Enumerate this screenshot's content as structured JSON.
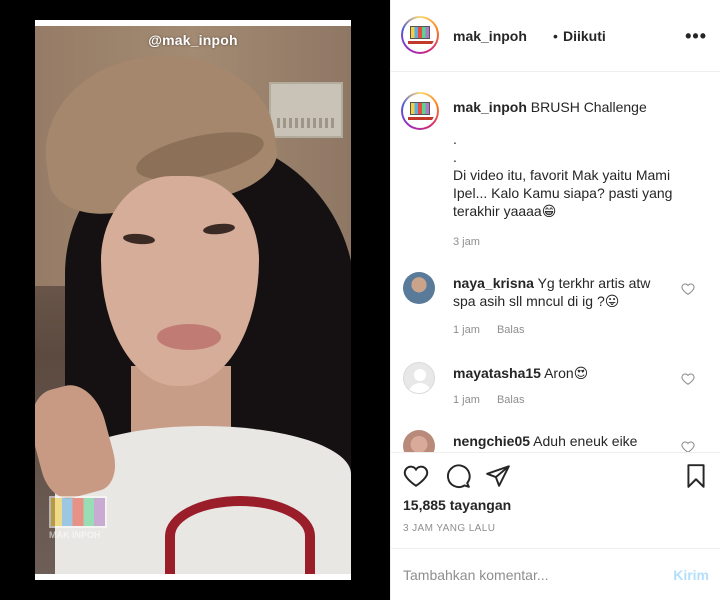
{
  "video": {
    "watermark": "@mak_inpoh",
    "logo_text": "MAK INPOH"
  },
  "header": {
    "username": "mak_inpoh",
    "separator": "•",
    "follow_status": "Diikuti",
    "more_icon": "more-horizontal-icon"
  },
  "caption": {
    "username": "mak_inpoh",
    "title": "BRUSH Challenge",
    "dot1": ".",
    "dot2": ".",
    "line1": "Di video itu, favorit Mak yaitu Mami",
    "line2": "Ipel... Kalo Kamu siapa? pasti yang",
    "line3": "terakhir yaaaa😁",
    "time": "3 jam"
  },
  "comments": [
    {
      "username": "naya_krisna",
      "text_line1": "Yg terkhr artis atw",
      "text_line2": "spa asih sll mncul di ig ?😛",
      "time": "1 jam",
      "reply": "Balas"
    },
    {
      "username": "mayatasha15",
      "text_line1": "Aron😍",
      "text_line2": "",
      "time": "1 jam",
      "reply": "Balas"
    },
    {
      "username": "nengchie05",
      "text_line1": "Aduh eneuk eike",
      "text_line2": "",
      "time": "",
      "reply": ""
    }
  ],
  "actions": {
    "icons": [
      "heart-icon",
      "comment-icon",
      "share-icon",
      "bookmark-icon"
    ],
    "views": "15,885 tayangan",
    "posted": "3 JAM YANG LALU"
  },
  "add_comment": {
    "placeholder": "Tambahkan komentar...",
    "post_label": "Kirim"
  },
  "colors": {
    "text": "#262626",
    "muted": "#8e8e8e",
    "post_disabled": "#b2dffc",
    "border": "#efefef"
  }
}
